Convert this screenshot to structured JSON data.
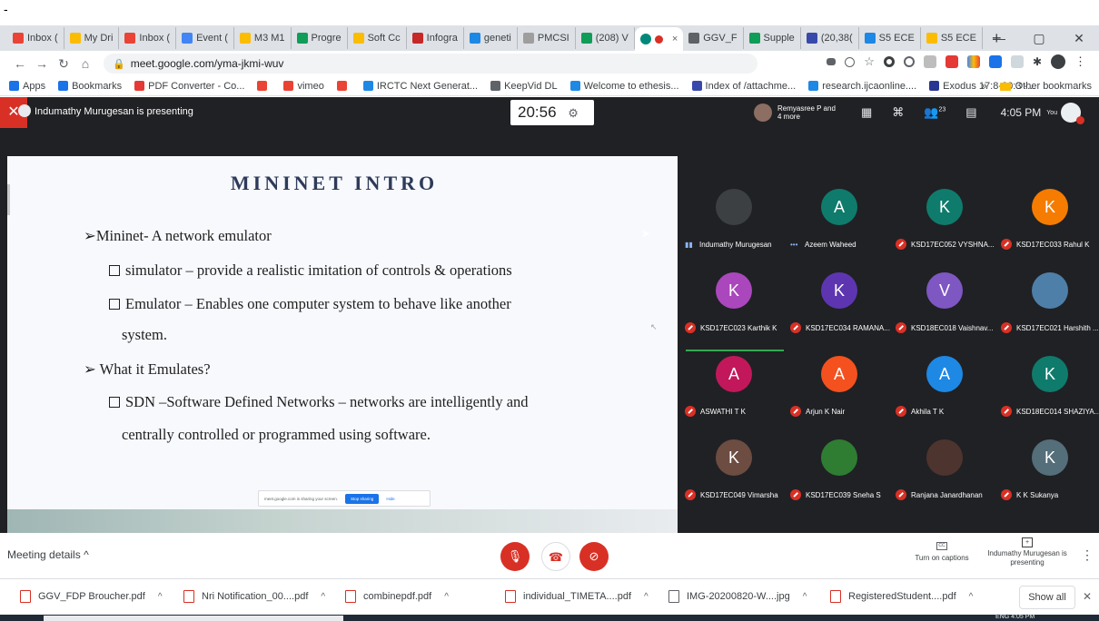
{
  "browser": {
    "tabs": [
      {
        "label": "Inbox (",
        "color": "#ea4335"
      },
      {
        "label": "My Dri",
        "color": "#fbbc04"
      },
      {
        "label": "Inbox (",
        "color": "#ea4335"
      },
      {
        "label": "Event (",
        "color": "#4285f4"
      },
      {
        "label": "M3 M1",
        "color": "#fbbc04"
      },
      {
        "label": "Progre",
        "color": "#0f9d58"
      },
      {
        "label": "Soft Cc",
        "color": "#fbbc04"
      },
      {
        "label": "Infogra",
        "color": "#c62828"
      },
      {
        "label": "geneti",
        "color": "#1e88e5"
      },
      {
        "label": "PMCSI",
        "color": "#9e9e9e"
      },
      {
        "label": "(208) V",
        "color": "#0f9d58"
      }
    ],
    "active_tab_close": "×",
    "tabs_right": [
      {
        "label": "GGV_F",
        "color": "#5f6368"
      },
      {
        "label": "Supple",
        "color": "#0f9d58"
      },
      {
        "label": "(20,38(",
        "color": "#3949ab"
      },
      {
        "label": "S5 ECE",
        "color": "#1e88e5"
      },
      {
        "label": "S5 ECE",
        "color": "#fbbc04"
      }
    ],
    "new_tab": "+",
    "window_controls": [
      "—",
      "▢",
      "✕"
    ],
    "url": "meet.google.com/yma-jkmi-wuv",
    "bookmarks": [
      {
        "label": "Apps",
        "color": "#1a73e8"
      },
      {
        "label": "Bookmarks",
        "color": "#1a73e8"
      },
      {
        "label": "PDF Converter - Co...",
        "color": "#e53935"
      },
      {
        "label": "",
        "color": "#ea4335"
      },
      {
        "label": "vimeo",
        "color": "#ea4335"
      },
      {
        "label": "",
        "color": "#ea4335"
      },
      {
        "label": "IRCTC Next Generat...",
        "color": "#1e88e5"
      },
      {
        "label": "KeepVid DL",
        "color": "#5f6368"
      },
      {
        "label": "Welcome to ethesis...",
        "color": "#1e88e5"
      },
      {
        "label": "Index of /attachme...",
        "color": "#3949ab"
      },
      {
        "label": "research.ijcaonline....",
        "color": "#1e88e5"
      },
      {
        "label": "Exodus 17:8-20:3 -...",
        "color": "#283593"
      }
    ],
    "bookmarks_more": "»",
    "other_bookmarks": "Other bookmarks"
  },
  "meet": {
    "presenter_banner": "Indumathy Murugesan is presenting",
    "timer": "20:56",
    "others_label": "Remyasree P and 4 more",
    "participant_count": "23",
    "clock": "4:05 PM",
    "you_label": "You",
    "slide": {
      "title": "MININET INTRO",
      "lines": [
        "➢Mininet- A network emulator",
        "simulator – provide a realistic imitation of controls & operations",
        "Emulator – Enables one computer system to behave like another",
        "system.",
        "➢ What it Emulates?",
        "SDN –Software Defined Networks – networks are intelligently and",
        "centrally controlled or programmed using software."
      ],
      "share_notice": "meet.google.com is sharing your screen.",
      "stop_sharing": "Stop sharing",
      "hide": "Hide"
    },
    "participants": [
      {
        "initial": "",
        "name": "Indumathy Murugesan",
        "color": "#3c4043",
        "muted": false,
        "speaking": true
      },
      {
        "initial": "A",
        "name": "Azeem Waheed",
        "color": "#0f7b6c",
        "muted": false,
        "speaking": false
      },
      {
        "initial": "K",
        "name": "KSD17EC052 VYSHNA...",
        "color": "#0f7b6c",
        "muted": true,
        "speaking": false
      },
      {
        "initial": "K",
        "name": "KSD17EC033 Rahul K",
        "color": "#f57c00",
        "muted": true,
        "speaking": false
      },
      {
        "initial": "K",
        "name": "KSD17EC023 Karthik K",
        "color": "#ab47bc",
        "muted": true,
        "speaking": false
      },
      {
        "initial": "K",
        "name": "KSD17EC034 RAMANA...",
        "color": "#5e35b1",
        "muted": true,
        "speaking": false
      },
      {
        "initial": "V",
        "name": "KSD18EC018 Vaishnav...",
        "color": "#7e57c2",
        "muted": true,
        "speaking": false
      },
      {
        "initial": "",
        "name": "KSD17EC021 Harshith ...",
        "color": "#4e7fa8",
        "muted": true,
        "speaking": false
      },
      {
        "initial": "A",
        "name": "ASWATHI T K",
        "color": "#c2185b",
        "muted": true,
        "speaking": false
      },
      {
        "initial": "A",
        "name": "Arjun K Nair",
        "color": "#f4511e",
        "muted": true,
        "speaking": false
      },
      {
        "initial": "A",
        "name": "Akhila T K",
        "color": "#1e88e5",
        "muted": true,
        "speaking": false
      },
      {
        "initial": "K",
        "name": "KSD18EC014 SHAZIYA...",
        "color": "#0f7b6c",
        "muted": true,
        "speaking": false
      },
      {
        "initial": "K",
        "name": "KSD17EC049 Vimarsha",
        "color": "#6d4c41",
        "muted": true,
        "speaking": false
      },
      {
        "initial": "",
        "name": "KSD17EC039 Sneha S",
        "color": "#2e7d32",
        "muted": true,
        "speaking": false
      },
      {
        "initial": "",
        "name": "Ranjana Janardhanan",
        "color": "#4e342e",
        "muted": true,
        "speaking": false
      },
      {
        "initial": "K",
        "name": "K K Sukanya",
        "color": "#546e7a",
        "muted": true,
        "speaking": false
      }
    ],
    "bottom": {
      "meeting_details": "Meeting details",
      "captions": "Turn on captions",
      "presenting": "Indumathy Murugesan is presenting"
    }
  },
  "downloads": {
    "items": [
      {
        "name": "GGV_FDP Broucher.pdf",
        "type": "pdf"
      },
      {
        "name": "Nri Notification_00....pdf",
        "type": "pdf"
      },
      {
        "name": "combinepdf.pdf",
        "type": "pdf"
      },
      {
        "name": "individual_TIMETA....pdf",
        "type": "pdf"
      },
      {
        "name": "IMG-20200820-W....jpg",
        "type": "img"
      },
      {
        "name": "RegisteredStudent....pdf",
        "type": "pdf"
      }
    ],
    "show_all": "Show all"
  },
  "taskbar": {
    "lang": "ENG",
    "time": "4:05 PM"
  }
}
